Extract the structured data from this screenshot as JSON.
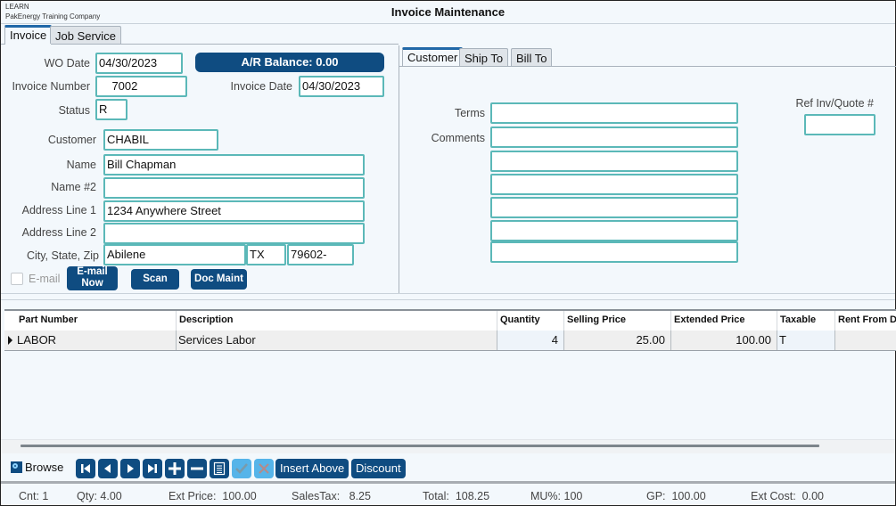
{
  "header": {
    "company_code": "LEARN",
    "company_name": "PakEnergy Training Company",
    "title": "Invoice Maintenance"
  },
  "main_tabs": [
    {
      "label": "Invoice",
      "active": true
    },
    {
      "label": "Job Service",
      "active": false
    }
  ],
  "invoice": {
    "wo_date_label": "WO Date",
    "wo_date": "04/30/2023",
    "ar_balance_label": "A/R Balance:  0.00",
    "invoice_number_label": "Invoice Number",
    "invoice_number": "    7002",
    "invoice_date_label": "Invoice Date",
    "invoice_date": "04/30/2023",
    "status_label": "Status",
    "status": "R",
    "customer_label": "Customer",
    "customer": "CHABIL",
    "name_label": "Name",
    "name": "Bill Chapman",
    "name2_label": "Name #2",
    "name2": "",
    "address1_label": "Address Line 1",
    "address1": "1234 Anywhere Street",
    "address2_label": "Address Line 2",
    "address2": "",
    "city_state_zip_label": "City, State, Zip",
    "city": "Abilene",
    "state": "TX",
    "zip": "79602-",
    "email_label": "E-mail",
    "email_checked": false,
    "email_now_line1": "E-mail",
    "email_now_line2": "Now",
    "scan_label": "Scan",
    "doc_maint_label": "Doc Maint"
  },
  "sub_tabs": [
    {
      "label": "Customer",
      "active": true
    },
    {
      "label": "Ship To",
      "active": false
    },
    {
      "label": "Bill To",
      "active": false
    }
  ],
  "customer_tab": {
    "terms_label": "Terms",
    "terms": "",
    "comments_label": "Comments",
    "comments": [
      "",
      "",
      "",
      "",
      "",
      ""
    ],
    "ref_label": "Ref Inv/Quote #",
    "ref": ""
  },
  "grid": {
    "columns": [
      "Part Number",
      "Description",
      "Quantity",
      "Selling Price",
      "Extended Price",
      "Taxable",
      "Rent From D"
    ],
    "rows": [
      {
        "part_number": "LABOR",
        "description": "Services Labor",
        "quantity": "4",
        "selling_price": "25.00",
        "extended_price": "100.00",
        "taxable": "T",
        "rent_from": ""
      }
    ]
  },
  "toolbar": {
    "browse_label": "Browse",
    "nav_buttons": [
      "first-record",
      "previous-record",
      "next-record",
      "last-record",
      "add-record",
      "delete-record",
      "notes"
    ],
    "confirm_enabled": false,
    "cancel_enabled": false,
    "insert_above_label": "Insert Above",
    "discount_label": "Discount"
  },
  "status_bar": {
    "cnt": "Cnt: 1",
    "qty": "Qty: 4.00",
    "ext_price": "Ext Price:  100.00",
    "sales_tax": "SalesTax:   8.25",
    "total": "Total:  108.25",
    "mu_pct": "MU%: 100",
    "gp": "GP:  100.00",
    "ext_cost": "Ext Cost:  0.00"
  },
  "colors": {
    "accent_dark": "#0f4c81",
    "field_border": "#5bb8b8",
    "disabled_button": "#56b4e9",
    "background": "#f3f8fc"
  }
}
